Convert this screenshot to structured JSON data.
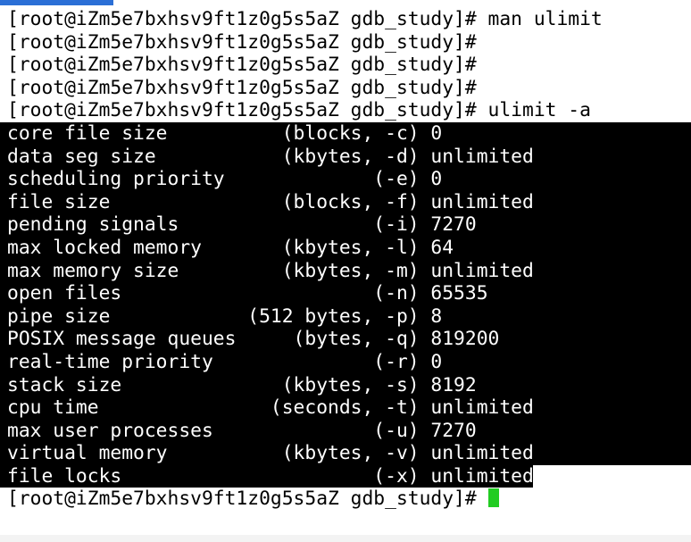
{
  "window": {
    "tab_color": "#2b6fd6",
    "cursor_color": "#22cc22"
  },
  "terminal": {
    "prompt": "[root@iZm5e7bxhsv9ft1z0g5s5aZ gdb_study]#",
    "commands": [
      {
        "cmd": "man ulimit"
      },
      {
        "cmd": ""
      },
      {
        "cmd": ""
      },
      {
        "cmd": ""
      },
      {
        "cmd": "ulimit -a"
      }
    ],
    "output": [
      "core file size          (blocks, -c) 0",
      "data seg size           (kbytes, -d) unlimited",
      "scheduling priority             (-e) 0",
      "file size               (blocks, -f) unlimited",
      "pending signals                 (-i) 7270",
      "max locked memory       (kbytes, -l) 64",
      "max memory size         (kbytes, -m) unlimited",
      "open files                      (-n) 65535",
      "pipe size            (512 bytes, -p) 8",
      "POSIX message queues     (bytes, -q) 819200",
      "real-time priority              (-r) 0",
      "stack size              (kbytes, -s) 8192",
      "cpu time               (seconds, -t) unlimited",
      "max user processes              (-u) 7270",
      "virtual memory          (kbytes, -v) unlimited",
      "file locks                      (-x) unlimited"
    ],
    "final_prompt": "[root@iZm5e7bxhsv9ft1z0g5s5aZ gdb_study]#"
  }
}
